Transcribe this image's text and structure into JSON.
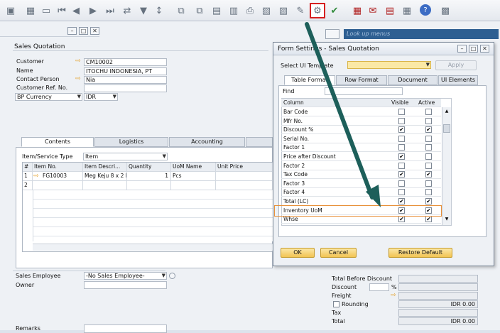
{
  "toolbar": {
    "icons": [
      "binoculars-icon",
      "binoculars-icon",
      "blank-icon",
      "first-record-icon",
      "previous-record-icon",
      "next-record-icon",
      "last-record-icon",
      "refresh-icon",
      "filter-icon",
      "sort-icon",
      "copy-to-icon",
      "copy-from-icon",
      "form-settings-icon",
      "document-icon",
      "print-icon",
      "preview-icon",
      "pencil-icon",
      "form-settings-highlight-icon",
      "approve-icon",
      "calendar-icon",
      "message-icon",
      "document-icon",
      "help-icon"
    ],
    "lookup_placeholder": "Look up menus"
  },
  "main": {
    "title": "Sales Quotation",
    "fields": [
      {
        "label": "Customer",
        "value": "CM10002"
      },
      {
        "label": "Name",
        "value": "ITOCHU INDONESIA, PT"
      },
      {
        "label": "Contact Person",
        "value": "Nia"
      },
      {
        "label": "Customer Ref. No.",
        "value": ""
      },
      {
        "label": "BP Currency",
        "value": "IDR"
      }
    ],
    "tabs": [
      "Contents",
      "Logistics",
      "Accounting"
    ],
    "item_service_type_label": "Item/Service Type",
    "item_service_type_value": "Item",
    "grid": {
      "headers": [
        "#",
        "Item No.",
        "Item Descri...",
        "Quantity",
        "UoM Name",
        "Unit Price"
      ],
      "rows": [
        [
          "1",
          "FG10003",
          "Meg Keju 8 x 2 K",
          "1",
          "Pcs",
          ""
        ],
        [
          "2",
          "",
          "",
          "",
          "",
          ""
        ]
      ]
    },
    "sales_employee_label": "Sales Employee",
    "sales_employee_value": "-No Sales Employee-",
    "owner_label": "Owner",
    "remarks_label": "Remarks",
    "totals": [
      {
        "label": "Total Before Discount",
        "value": ""
      },
      {
        "label": "Discount",
        "value": "",
        "unit": "%"
      },
      {
        "label": "Freight",
        "value": ""
      },
      {
        "label": "Rounding",
        "value": "IDR 0.00"
      },
      {
        "label": "Tax",
        "value": ""
      },
      {
        "label": "Total",
        "value": "IDR 0.00"
      }
    ]
  },
  "dialog": {
    "title": "Form Settings - Sales Quotation",
    "select_template_label": "Select UI Template",
    "apply_label": "Apply",
    "tabs": [
      "Table Format",
      "Row Format",
      "Document",
      "UI Elements"
    ],
    "find_label": "Find",
    "col_headers": [
      "Column",
      "Visible",
      "Active"
    ],
    "rows": [
      {
        "name": "Bar Code",
        "visible": false,
        "active": false
      },
      {
        "name": "Mfr No.",
        "visible": false,
        "active": false
      },
      {
        "name": "Discount %",
        "visible": true,
        "active": true
      },
      {
        "name": "Serial No.",
        "visible": false,
        "active": false
      },
      {
        "name": "Factor 1",
        "visible": false,
        "active": false
      },
      {
        "name": "Price after Discount",
        "visible": true,
        "active": false
      },
      {
        "name": "Factor 2",
        "visible": false,
        "active": false
      },
      {
        "name": "Tax Code",
        "visible": true,
        "active": true
      },
      {
        "name": "Factor 3",
        "visible": false,
        "active": false
      },
      {
        "name": "Factor 4",
        "visible": false,
        "active": false
      },
      {
        "name": "Total (LC)",
        "visible": true,
        "active": true
      },
      {
        "name": "Inventory UoM",
        "visible": true,
        "active": true
      },
      {
        "name": "Whse",
        "visible": true,
        "active": true
      }
    ],
    "ok_label": "OK",
    "cancel_label": "Cancel",
    "restore_label": "Restore Default"
  },
  "colors": {
    "highlight_box": "#e8913a",
    "arrow": "#1d5f5a",
    "button": "#f2c452"
  }
}
